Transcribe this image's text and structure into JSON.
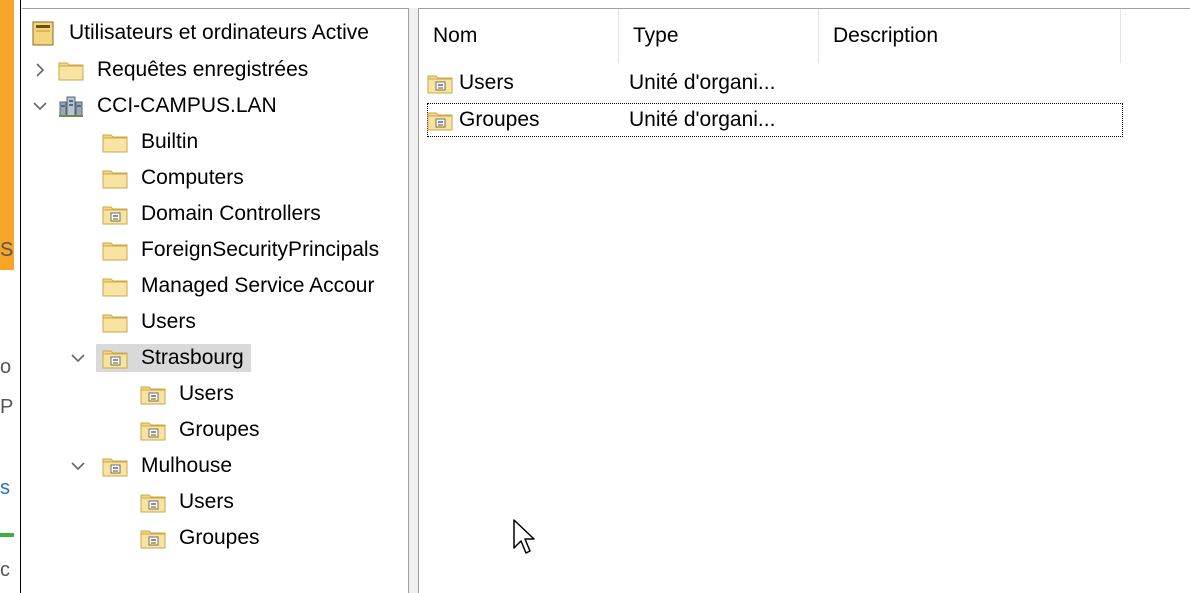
{
  "tree": {
    "root": {
      "label": "Utilisateurs et ordinateurs Active"
    },
    "saved_queries": {
      "label": "Requêtes enregistrées"
    },
    "domain": {
      "label": "CCI-CAMPUS.LAN"
    },
    "items": [
      {
        "label": "Builtin"
      },
      {
        "label": "Computers"
      },
      {
        "label": "Domain Controllers"
      },
      {
        "label": "ForeignSecurityPrincipals"
      },
      {
        "label": "Managed Service Accour"
      },
      {
        "label": "Users"
      }
    ],
    "strasbourg": {
      "label": "Strasbourg",
      "children": [
        {
          "label": "Users"
        },
        {
          "label": "Groupes"
        }
      ]
    },
    "mulhouse": {
      "label": "Mulhouse",
      "children": [
        {
          "label": "Users"
        },
        {
          "label": "Groupes"
        }
      ]
    }
  },
  "list": {
    "columns": [
      "Nom",
      "Type",
      "Description"
    ],
    "rows": [
      {
        "name": "Users",
        "type": "Unité d'organi...",
        "description": ""
      },
      {
        "name": "Groupes",
        "type": "Unité d'organi...",
        "description": ""
      }
    ]
  },
  "left_strip": {
    "fragments": [
      "S",
      "o",
      "P",
      "s",
      "c"
    ]
  },
  "colors": {
    "folder": "#f3d67e",
    "ou_badge": "#c8a64a",
    "selection": "#d9d9d9",
    "orange": "#f7a62a"
  }
}
